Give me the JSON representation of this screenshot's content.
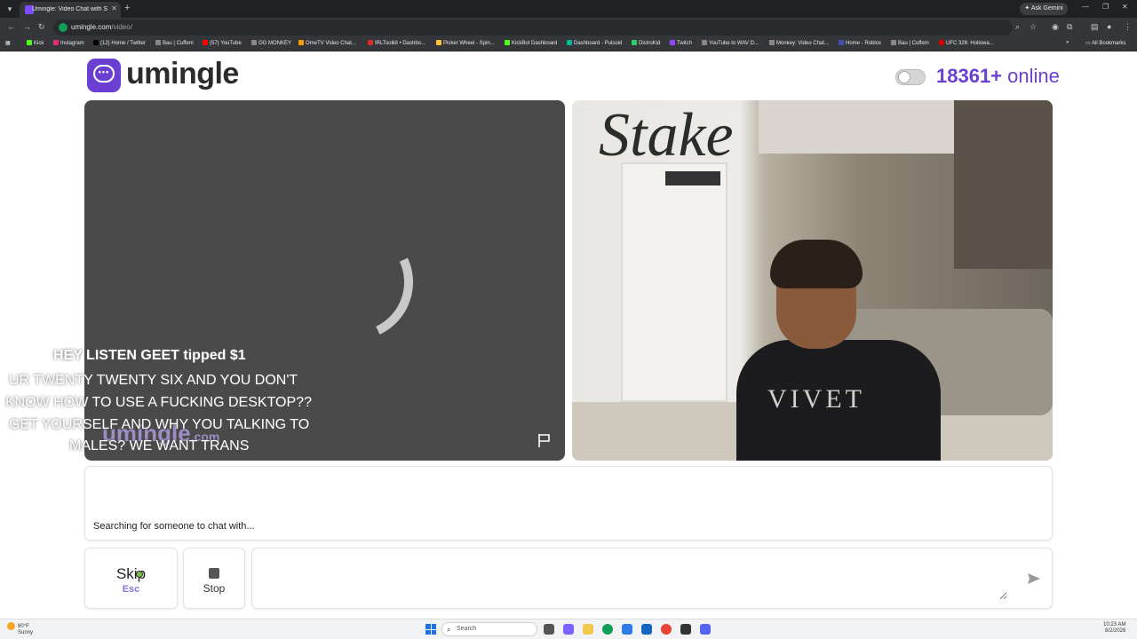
{
  "browser": {
    "tab_title": "Umingle: Video Chat with S",
    "url_host": "umingle.com",
    "url_path": "/video/",
    "ask_gemini": "Ask Gemini",
    "bookmarks": [
      "Kick",
      "Instagram",
      "(12) Home / Twitter",
      "Bau | Cuffem",
      "(57) YouTube",
      "OG MONKEY",
      "OmeTV Video Chat...",
      "IRLToolkit • Dashbo...",
      "Picker Wheel - Spin...",
      "KickBot Dashboard",
      "Dashboard - Pulsoid",
      "DistroKid",
      "Twitch",
      "YouTube to WAV D...",
      "Monkey: Video Chat...",
      "Home - Roblox",
      "Bau | Cuffem",
      "UFC 326: Hollowa..."
    ],
    "all_bookmarks": "All Bookmarks"
  },
  "header": {
    "logo_text": "umingle",
    "online_count": "18361+",
    "online_label": "online"
  },
  "video_left": {
    "watermark": "umingle",
    "watermark_suffix": ".com"
  },
  "video_right": {
    "sign_text": "Stake",
    "shirt_text": "VIVET"
  },
  "overlay": {
    "tip_line": "HEY LISTEN GEET tipped $1",
    "message_lines": [
      "UR TWENTY TWENTY SIX AND YOU DON'T",
      "KNOW HOW TO USE A FUCKING DESKTOP??",
      "GET YOURSELF AND WHY YOU TALKING TO",
      "MALES? WE WANT TRANS"
    ]
  },
  "chat": {
    "status": "Searching for someone to chat with..."
  },
  "controls": {
    "skip_label": "Skip",
    "skip_key": "Esc",
    "stop_label": "Stop",
    "message_placeholder": ""
  },
  "taskbar": {
    "weather_temp": "80°F",
    "weather_desc": "Sunny",
    "search_label": "Search",
    "time": "10:23 AM",
    "date": "8/2/2026"
  },
  "colors": {
    "brand": "#6a3fd1",
    "online": "#6a3fd1",
    "skip_key": "#8f72e0"
  }
}
